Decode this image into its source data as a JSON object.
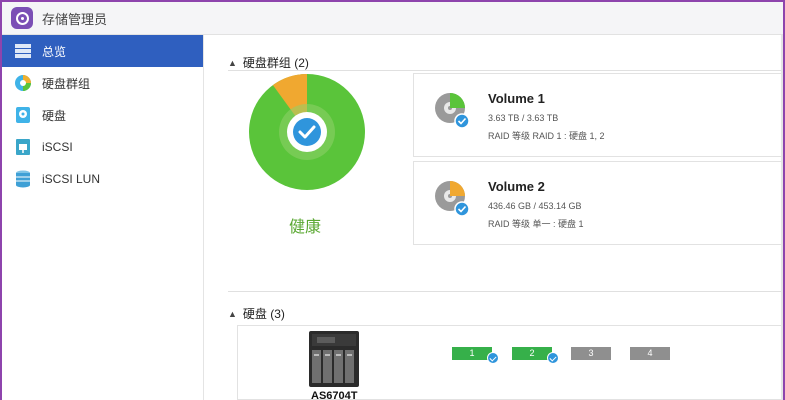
{
  "window": {
    "title": "存储管理员"
  },
  "sidebar": {
    "items": [
      {
        "label": "总览",
        "icon": "overview-icon",
        "active": true
      },
      {
        "label": "硬盘群组",
        "icon": "disk-group-icon",
        "active": false
      },
      {
        "label": "硬盘",
        "icon": "disk-icon",
        "active": false
      },
      {
        "label": "iSCSI",
        "icon": "iscsi-icon",
        "active": false
      },
      {
        "label": "iSCSI LUN",
        "icon": "iscsi-lun-icon",
        "active": false
      }
    ]
  },
  "disk_groups": {
    "header": "硬盘群组 (2)",
    "status": "健康",
    "usage_chart": {
      "used_fraction": 0.9,
      "free_fraction": 0.1
    },
    "volumes": [
      {
        "name": "Volume 1",
        "capacity": "3.63 TB / 3.63 TB",
        "raid": "RAID 等级 RAID 1 : 硬盘 1, 2"
      },
      {
        "name": "Volume 2",
        "capacity": "436.46 GB / 453.14 GB",
        "raid": "RAID 等级 单一 : 硬盘 1"
      }
    ]
  },
  "disks": {
    "header": "硬盘 (3)",
    "device": "AS6704T",
    "bays": [
      {
        "label": "1",
        "installed": true
      },
      {
        "label": "2",
        "installed": true
      },
      {
        "label": "3",
        "installed": false
      },
      {
        "label": "4",
        "installed": false
      }
    ]
  },
  "colors": {
    "accent": "#2f5fbf",
    "healthy": "#5ac43a",
    "warning": "#f0a830",
    "frame": "#8e44ad"
  }
}
